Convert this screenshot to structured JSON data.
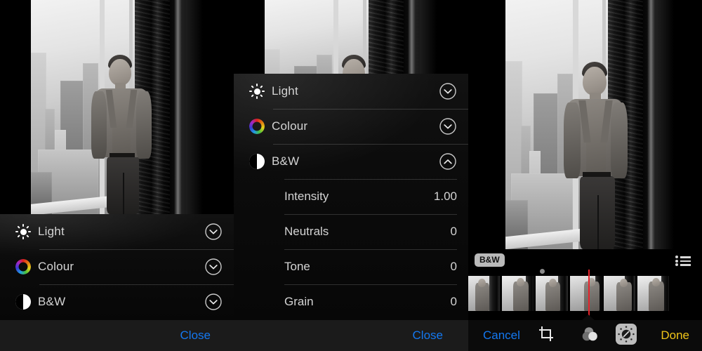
{
  "app": {
    "title": "Photos Editor",
    "screens": 3
  },
  "adjust_panel": {
    "groups": [
      {
        "id": "light",
        "label": "Light",
        "icon": "sun-icon",
        "chevron": "chevron-down-icon",
        "expanded": false
      },
      {
        "id": "colour",
        "label": "Colour",
        "icon": "color-wheel-icon",
        "chevron": "chevron-down-icon",
        "expanded": false
      },
      {
        "id": "bw",
        "label": "B&W",
        "icon": "bw-contrast-icon",
        "chevron": "chevron-down-icon",
        "expanded": false
      }
    ],
    "bw_sub": [
      {
        "label": "Intensity",
        "value": "1.00"
      },
      {
        "label": "Neutrals",
        "value": "0"
      },
      {
        "label": "Tone",
        "value": "0"
      },
      {
        "label": "Grain",
        "value": "0"
      }
    ]
  },
  "left_screen": {
    "groups": [
      {
        "label": "Light",
        "icon": "sun-icon"
      },
      {
        "label": "Colour",
        "icon": "color-wheel-icon"
      },
      {
        "label": "B&W",
        "icon": "bw-contrast-icon"
      }
    ],
    "toolbar": {
      "close_label": "Close"
    }
  },
  "middle_screen": {
    "groups": [
      {
        "label": "Light",
        "icon": "sun-icon",
        "chevron": "chevron-down-icon"
      },
      {
        "label": "Colour",
        "icon": "color-wheel-icon",
        "chevron": "chevron-down-icon"
      },
      {
        "label": "B&W",
        "icon": "bw-contrast-icon",
        "chevron": "chevron-up-icon"
      }
    ],
    "sub_items": [
      {
        "label": "Intensity",
        "value": "1.00"
      },
      {
        "label": "Neutrals",
        "value": "0"
      },
      {
        "label": "Tone",
        "value": "0"
      },
      {
        "label": "Grain",
        "value": "0"
      }
    ],
    "toolbar": {
      "close_label": "Close"
    }
  },
  "right_screen": {
    "badge_label": "B&W",
    "list_icon": "bulleted-list-icon",
    "filmstrip": {
      "frames": 6,
      "playhead_color": "#e8222a"
    },
    "toolbar": {
      "cancel_label": "Cancel",
      "crop_icon": "crop-icon",
      "filters_icon": "filters-icon",
      "adjust_icon": "adjust-dial-icon",
      "adjust_selected": true,
      "done_label": "Done"
    }
  },
  "colors": {
    "accent_blue": "#1478f0",
    "accent_yellow": "#f0c419",
    "sheet_bg": "#0c0c0c",
    "toolbar_bg": "#1b1b1b",
    "label": "#d4d4d4",
    "playhead": "#e8222a",
    "badge_bg": "#b9b9b9"
  }
}
